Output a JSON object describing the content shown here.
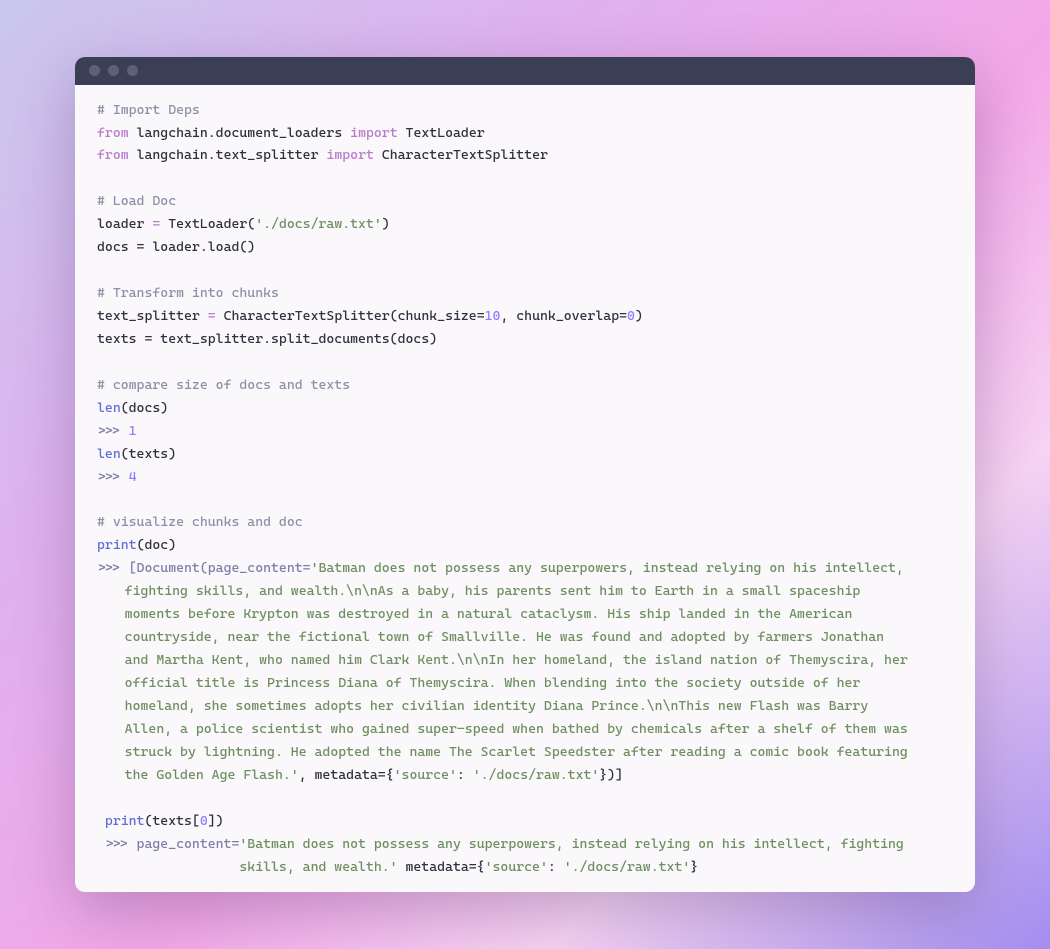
{
  "code": {
    "c1": "# Import Deps",
    "l1_from": "from",
    "l1_mod": "langchain.document_loaders",
    "l1_import": "import",
    "l1_name": "TextLoader",
    "l2_from": "from",
    "l2_mod": "langchain.text_splitter",
    "l2_import": "import",
    "l2_name": "CharacterTextSplitter",
    "c2": "# Load Doc",
    "l3_a": "loader ",
    "l3_b": "=",
    "l3_c": " TextLoader(",
    "l3_d": "'./docs/raw.txt'",
    "l3_e": ")",
    "l4": "docs = loader.load()",
    "c3": "# Transform into chunks",
    "l5_a": "text_splitter ",
    "l5_b": "=",
    "l5_c": " CharacterTextSplitter(chunk_size=",
    "l5_d": "10",
    "l5_e": ", chunk_overlap=",
    "l5_f": "0",
    "l5_g": ")",
    "l6": "texts = text_splitter.split_documents(docs)",
    "c4": "# compare size of docs and texts",
    "l7_a": "len",
    "l7_b": "(docs)",
    "l8_a": ">>> ",
    "l8_b": "1",
    "l9_a": "len",
    "l9_b": "(texts)",
    "l10_a": ">>> ",
    "l10_b": "4",
    "c5": "# visualize chunks and doc",
    "l11_a": "print",
    "l11_b": "(doc)",
    "out1_head": ">>> [Document(page_content=",
    "out1_str1": "'Batman does not possess any superpowers, instead relying on his intellect, ",
    "out1_c1": "fighting skills, and wealth.\\n\\nAs a baby, his parents sent him to Earth in a small spaceship ",
    "out1_c2": "moments before Krypton was destroyed in a natural cataclysm. His ship landed in the American ",
    "out1_c3": "countryside, near the fictional town of Smallville. He was found and adopted by farmers Jonathan ",
    "out1_c4": "and Martha Kent, who named him Clark Kent.\\n\\nIn her homeland, the island nation of Themyscira, her ",
    "out1_c5": "official title is Princess Diana of Themyscira. When blending into the society outside of her ",
    "out1_c6": "homeland, she sometimes adopts her civilian identity Diana Prince.\\n\\nThis new Flash was Barry ",
    "out1_c7": "Allen, a police scientist who gained super-speed when bathed by chemicals after a shelf of them was ",
    "out1_c8": "struck by lightning. He adopted the name The Scarlet Speedster after reading a comic book featuring ",
    "out1_c9": "the Golden Age Flash.'",
    "out1_tail_a": ", metadata={",
    "out1_tail_b": "'source'",
    "out1_tail_c": ": ",
    "out1_tail_d": "'./docs/raw.txt'",
    "out1_tail_e": "})]",
    "l12_a": "print",
    "l12_b": "(texts[",
    "l12_c": "0",
    "l12_d": "])",
    "out2_head": ">>> page_content=",
    "out2_str1": "'Batman does not possess any superpowers, instead relying on his intellect, fighting ",
    "out2_c1": "skills, and wealth.'",
    "out2_tail_a": " metadata={",
    "out2_tail_b": "'source'",
    "out2_tail_c": ": ",
    "out2_tail_d": "'./docs/raw.txt'",
    "out2_tail_e": "}"
  }
}
